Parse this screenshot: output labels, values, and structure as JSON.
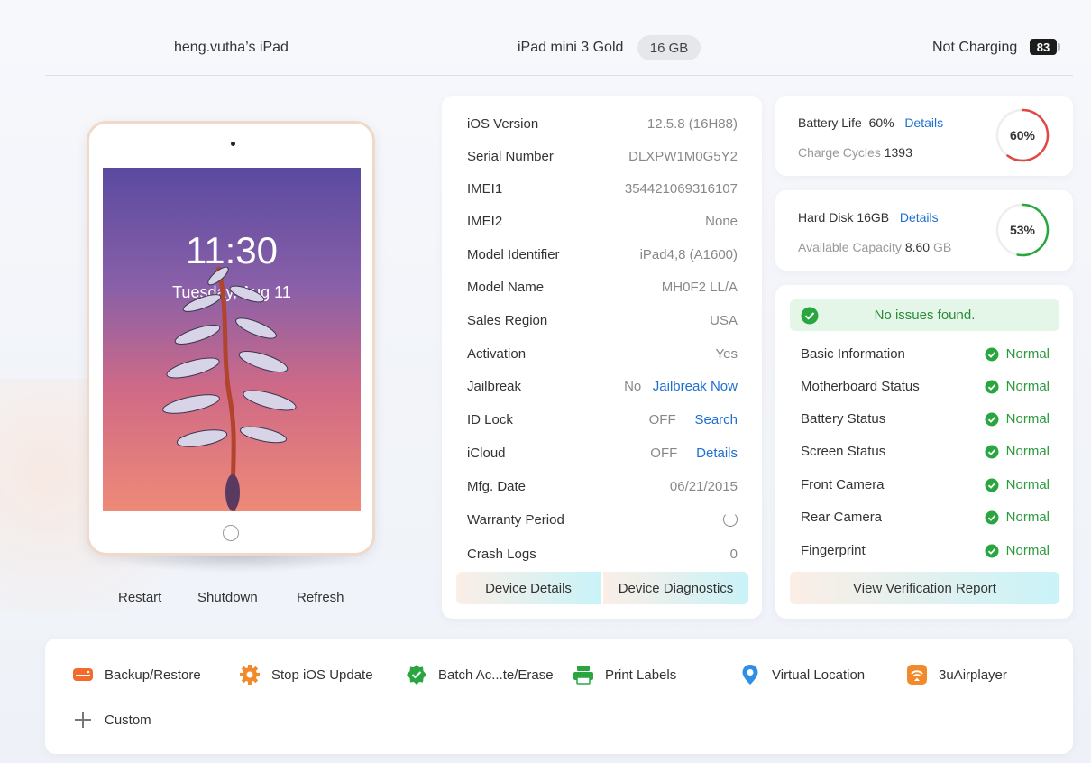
{
  "header": {
    "device_name": "heng.vutha’s iPad",
    "model": "iPad mini 3 Gold",
    "capacity": "16 GB",
    "charging_status": "Not Charging",
    "battery_level": "83"
  },
  "device_preview": {
    "lock_time": "11:30",
    "lock_date": "Tuesday, Aug 11",
    "actions": [
      "Restart",
      "Shutdown",
      "Refresh"
    ]
  },
  "info": {
    "rows": [
      {
        "label": "iOS Version",
        "value": "12.5.8 (16H88)"
      },
      {
        "label": "Serial Number",
        "value": "DLXPW1M0G5Y2"
      },
      {
        "label": "IMEI1",
        "value": "354421069316107"
      },
      {
        "label": "IMEI2",
        "value": "None"
      },
      {
        "label": "Model Identifier",
        "value": "iPad4,8 (A1600)"
      },
      {
        "label": "Model Name",
        "value": "MH0F2 LL/A"
      },
      {
        "label": "Sales Region",
        "value": "USA"
      },
      {
        "label": "Activation",
        "value": "Yes"
      },
      {
        "label": "Jailbreak",
        "value": "No",
        "link": "Jailbreak Now"
      },
      {
        "label": "ID Lock",
        "value": "OFF",
        "link": "Search"
      },
      {
        "label": "iCloud",
        "value": "OFF",
        "link": "Details"
      },
      {
        "label": "Mfg. Date",
        "value": "06/21/2015"
      },
      {
        "label": "Warranty Period",
        "value": ""
      },
      {
        "label": "Crash Logs",
        "value": "0"
      }
    ],
    "buttons": {
      "device_details": "Device Details",
      "device_diagnostics": "Device Diagnostics"
    }
  },
  "battery": {
    "label": "Battery Life",
    "percent_text": "60%",
    "details_link": "Details",
    "cycles_label": "Charge Cycles",
    "cycles_value": "1393",
    "ring_text": "60%",
    "ring_fraction": 0.6,
    "ring_color": "#e04848"
  },
  "disk": {
    "label": "Hard Disk 16GB",
    "details_link": "Details",
    "available_label": "Available Capacity",
    "available_value": "8.60",
    "available_unit": "GB",
    "ring_text": "53%",
    "ring_fraction": 0.53,
    "ring_color": "#2aa640"
  },
  "diagnostics": {
    "summary": "No issues found.",
    "rows": [
      {
        "label": "Basic Information",
        "status": "Normal"
      },
      {
        "label": "Motherboard Status",
        "status": "Normal"
      },
      {
        "label": "Battery Status",
        "status": "Normal"
      },
      {
        "label": "Screen Status",
        "status": "Normal"
      },
      {
        "label": "Front Camera",
        "status": "Normal"
      },
      {
        "label": "Rear Camera",
        "status": "Normal"
      },
      {
        "label": "Fingerprint",
        "status": "Normal"
      }
    ],
    "report_button": "View Verification Report"
  },
  "tools": [
    {
      "label": "Backup/Restore",
      "icon": "backup-icon",
      "color": "#f26b2c"
    },
    {
      "label": "Stop iOS Update",
      "icon": "gear-icon",
      "color": "#f28a2c"
    },
    {
      "label": "Batch Ac...te/Erase",
      "icon": "badge-check-icon",
      "color": "#2aa640"
    },
    {
      "label": "Print Labels",
      "icon": "printer-icon",
      "color": "#2aa640"
    },
    {
      "label": "Virtual Location",
      "icon": "location-pin-icon",
      "color": "#2d8fe6"
    },
    {
      "label": "3uAirplayer",
      "icon": "airplay-icon",
      "color": "#f28a2c"
    },
    {
      "label": "Custom",
      "icon": "plus-icon",
      "color": "#777777"
    }
  ],
  "colors": {
    "accent_link": "#1e6fd0",
    "normal_green": "#2d9a3e"
  }
}
